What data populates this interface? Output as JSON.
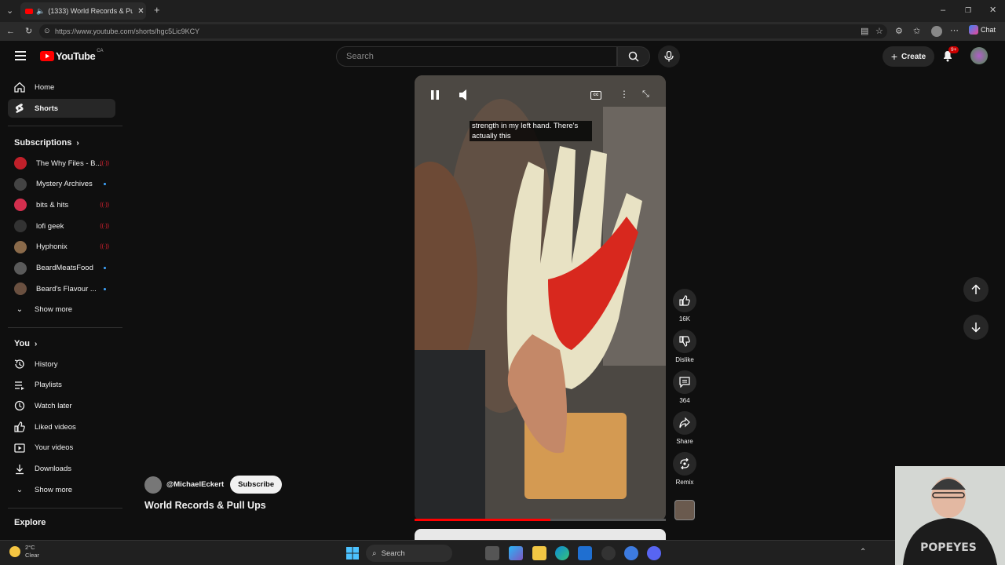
{
  "browser": {
    "tab_title": "(1333) World Records & Pull Ups",
    "url": "https://www.youtube.com/shorts/hgc5Lic9KCY",
    "chat_label": "Chat"
  },
  "header": {
    "logo_text": "YouTube",
    "region": "CA",
    "search_placeholder": "Search",
    "create_label": "Create",
    "notification_count": "9+"
  },
  "sidebar": {
    "home": "Home",
    "shorts": "Shorts",
    "subscriptions_heading": "Subscriptions",
    "subscriptions": [
      {
        "name": "The Why Files - B...",
        "status": "live",
        "color": "#c0202a"
      },
      {
        "name": "Mystery Archives",
        "status": "new",
        "color": "#444444"
      },
      {
        "name": "bits & hits",
        "status": "live",
        "color": "#d32f4e"
      },
      {
        "name": "lofi geek",
        "status": "live",
        "color": "#333333"
      },
      {
        "name": "Hyphonix",
        "status": "live",
        "color": "#8a6a4a"
      },
      {
        "name": "BeardMeatsFood",
        "status": "new",
        "color": "#5a5a5a"
      },
      {
        "name": "Beard's Flavour ...",
        "status": "new",
        "color": "#6a5040"
      }
    ],
    "show_more_1": "Show more",
    "you_heading": "You",
    "you_items": [
      {
        "label": "History",
        "icon": "history-icon"
      },
      {
        "label": "Playlists",
        "icon": "playlists-icon"
      },
      {
        "label": "Watch later",
        "icon": "watch-later-icon"
      },
      {
        "label": "Liked videos",
        "icon": "liked-videos-icon"
      },
      {
        "label": "Your videos",
        "icon": "your-videos-icon"
      },
      {
        "label": "Downloads",
        "icon": "downloads-icon"
      }
    ],
    "show_more_2": "Show more",
    "explore_heading": "Explore"
  },
  "short": {
    "caption": "strength in my left hand. There's actually this",
    "channel": "@MichaelEckert",
    "subscribe_label": "Subscribe",
    "title": "World Records & Pull Ups",
    "progress": 0.54,
    "likes": "16K",
    "dislike_label": "Dislike",
    "comments": "364",
    "share_label": "Share",
    "remix_label": "Remix"
  },
  "taskbar": {
    "weather_temp": "2°C",
    "weather_desc": "Clear",
    "search_label": "Search"
  },
  "colors": {
    "accent_red": "#ff0000",
    "background": "#0f0f0f"
  }
}
